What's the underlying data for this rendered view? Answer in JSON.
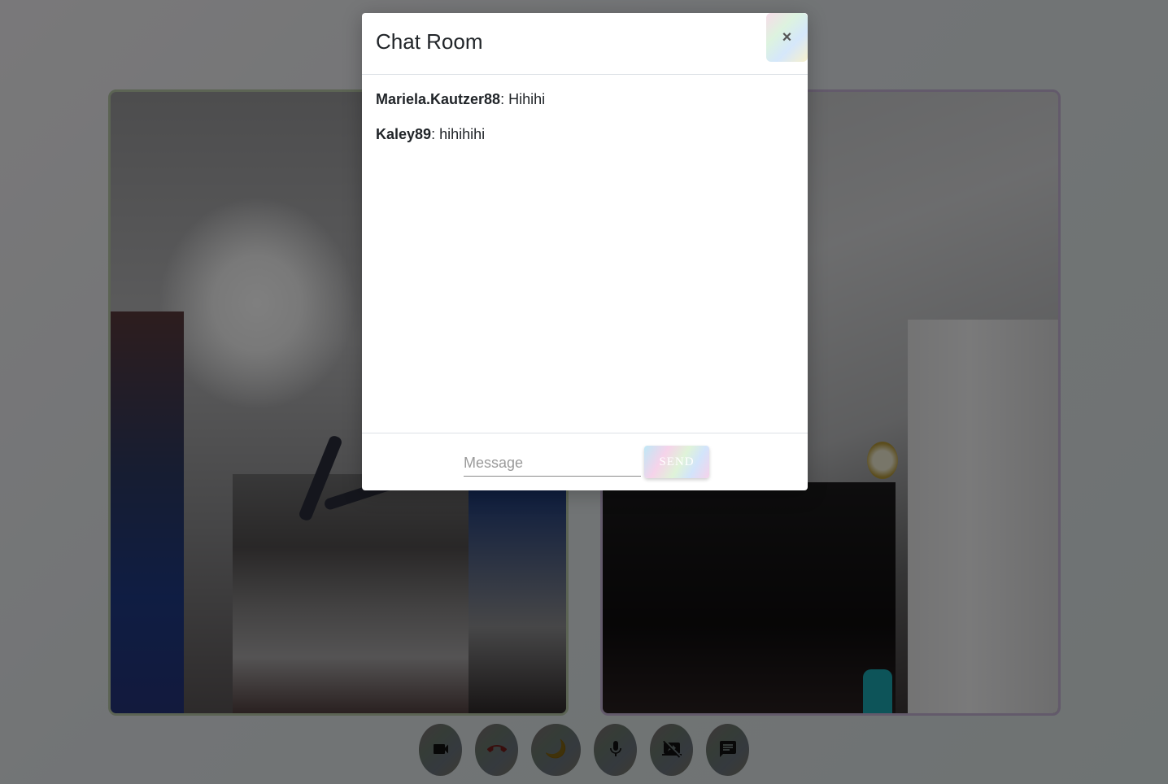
{
  "chat": {
    "title": "Chat Room",
    "close_label": "×",
    "messages": [
      {
        "user": "Mariela.Kautzer88",
        "separator": ": ",
        "text": "Hihihi"
      },
      {
        "user": "Kaley89",
        "separator": ": ",
        "text": "hihihihi"
      }
    ],
    "input": {
      "value": "",
      "placeholder": "Message"
    },
    "send_label": "SEND"
  },
  "controls": [
    {
      "name": "camera-toggle",
      "icon": "video-camera-icon"
    },
    {
      "name": "end-call",
      "icon": "phone-hangup-icon",
      "color": "#e53935"
    },
    {
      "name": "theme-toggle",
      "icon": "moon-icon",
      "glyph": "🌙"
    },
    {
      "name": "mic-toggle",
      "icon": "microphone-icon"
    },
    {
      "name": "screen-share-toggle",
      "icon": "stop-screen-share-icon"
    },
    {
      "name": "chat-toggle",
      "icon": "chat-icon"
    }
  ]
}
